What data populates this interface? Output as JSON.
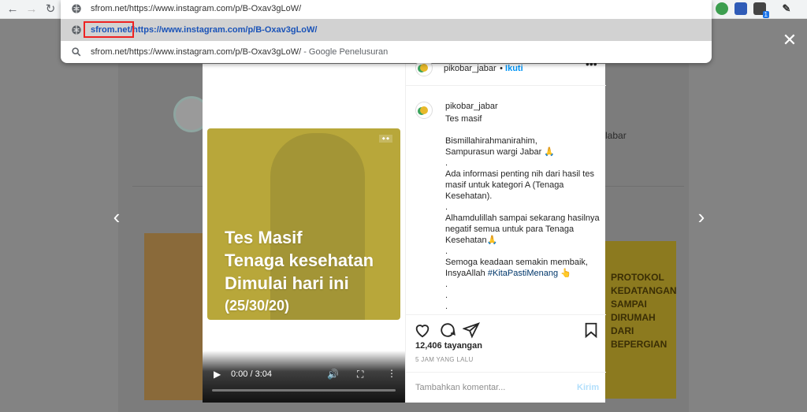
{
  "browser": {
    "address_text": "sfrom.net/https://www.instagram.com/p/B-Oxav3gLoW/",
    "suggestions": [
      {
        "text": "sfrom.net/https://www.instagram.com/p/B-Oxav3gLoW/",
        "suffix": "",
        "icon": "globe-icon"
      },
      {
        "text": "sfrom.net/https://www.instagram.com/p/B-Oxav3gLoW/",
        "suffix": " - Google Penelusuran",
        "icon": "search-icon"
      }
    ],
    "extension_badge": "1"
  },
  "background": {
    "profile_text": "labar",
    "right_post_text": "PROTOKOL KEDATANGAN SAMPAI DIRUMAH DARI BEPERGIAN"
  },
  "post": {
    "image_title_lines": [
      "Tes Masif",
      "Tenaga kesehatan",
      "Dimulai hari ini",
      "(25/30/20)"
    ],
    "video_time": "0:00 / 3:04",
    "video_progress": 0,
    "header_username": "pikobar_jabar",
    "header_follow": "Ikuti",
    "caption_username": "pikobar_jabar",
    "caption_lines": [
      "Tes masif",
      "",
      "Bismillahirahmanirahim,",
      "Sampurasun wargi Jabar 🙏",
      ".",
      "Ada informasi penting nih dari hasil tes masif untuk kategori A (Tenaga Kesehatan).",
      ".",
      "Alhamdulillah sampai sekarang hasilnya negatif semua untuk para Tenaga Kesehatan🙏",
      ".",
      "Semoga keadaan semakin membaik, InsyaAllah"
    ],
    "caption_hashtag": "#KitaPastiMenang",
    "caption_tail": [
      ".",
      ".",
      "."
    ],
    "views": "12,406 tayangan",
    "timestamp": "5 JAM YANG LALU",
    "comment_placeholder": "Tambahkan komentar...",
    "post_button": "Kirim"
  },
  "colors": {
    "accent_link": "#1a53b8",
    "highlight_box": "#e22222",
    "card_yellow": "#b8a73a"
  }
}
